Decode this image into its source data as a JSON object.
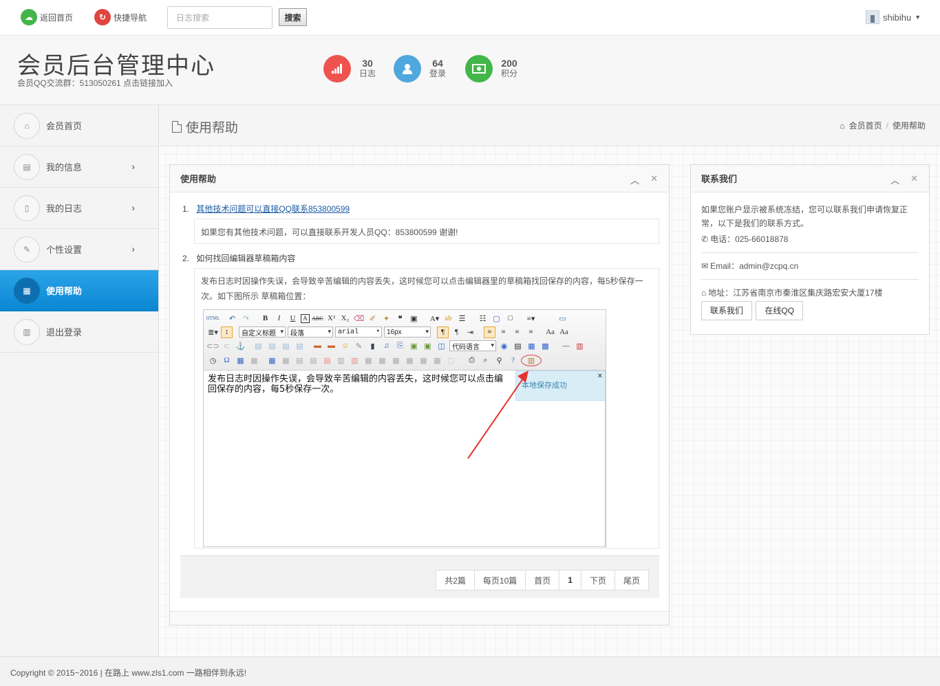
{
  "topbar": {
    "home_label": "返回首页",
    "nav_label": "快捷导航",
    "search_placeholder": "日志搜索",
    "search_button": "搜索",
    "username": "shibihu"
  },
  "header": {
    "title": "会员后台管理中心",
    "subtitle": "会员QQ交流群：513050261 点击链接加入",
    "stats": [
      {
        "value": "30",
        "label": "日志"
      },
      {
        "value": "64",
        "label": "登录"
      },
      {
        "value": "200",
        "label": "积分"
      }
    ]
  },
  "sidebar": {
    "items": [
      {
        "label": "会员首页"
      },
      {
        "label": "我的信息"
      },
      {
        "label": "我的日志"
      },
      {
        "label": "个性设置"
      },
      {
        "label": "使用帮助"
      },
      {
        "label": "退出登录"
      }
    ]
  },
  "page": {
    "title": "使用帮助",
    "breadcrumb_home": "会员首页",
    "breadcrumb_sep": "/",
    "breadcrumb_current": "使用帮助"
  },
  "help_panel": {
    "title": "使用帮助",
    "q1": {
      "num": "1.",
      "text": "其他技术问题可以直接QQ联系853800599",
      "answer": "如果您有其他技术问题，可以直接联系开发人员QQ：853800599 谢谢!"
    },
    "q2": {
      "num": "2.",
      "text": "如何找回编辑器草稿箱内容",
      "answer_line1": "发布日志时因操作失误，会导致辛苦编辑的内容丢失，这时候您可以点击编辑器里的草稿箱找回保存的内容，每5秒保存一",
      "answer_line2": "次。如下图所示 草稿箱位置："
    },
    "editor": {
      "sel_title": "自定义标题",
      "sel_para": "段落",
      "sel_font": "arial",
      "sel_size": "16px",
      "sel_code": "代码语言",
      "body_line1": "发布日志时因操作失误，会导致辛苦编辑的内容丢失，这时候您可以点击编",
      "body_line2": "回保存的内容，每5秒保存一次。",
      "toast": "本地保存成功",
      "toast_close": "×"
    },
    "pager": {
      "total": "共2篇",
      "per_page": "每页10篇",
      "first": "首页",
      "current": "1",
      "next": "下页",
      "last": "尾页"
    }
  },
  "contact_panel": {
    "title": "联系我们",
    "intro": "如果您账户显示被系统冻结，您可以联系我们申请恢复正常，以下是我们的联系方式。",
    "phone": "电话：025-66018878",
    "email": "Email：admin@zcpq.cn",
    "address": "地址：江苏省南京市秦淮区集庆路宏安大厦17楼",
    "btn_contact": "联系我们",
    "btn_qq": "在线QQ"
  },
  "footer": {
    "text": "Copyright © 2015~2016 | 在路上 www.zls1.com 一路相伴到永远!"
  },
  "colors": {
    "accent": "#0a86d3",
    "stat_red": "#ef5350",
    "stat_blue": "#4ea7dd",
    "stat_green": "#43b64a"
  }
}
